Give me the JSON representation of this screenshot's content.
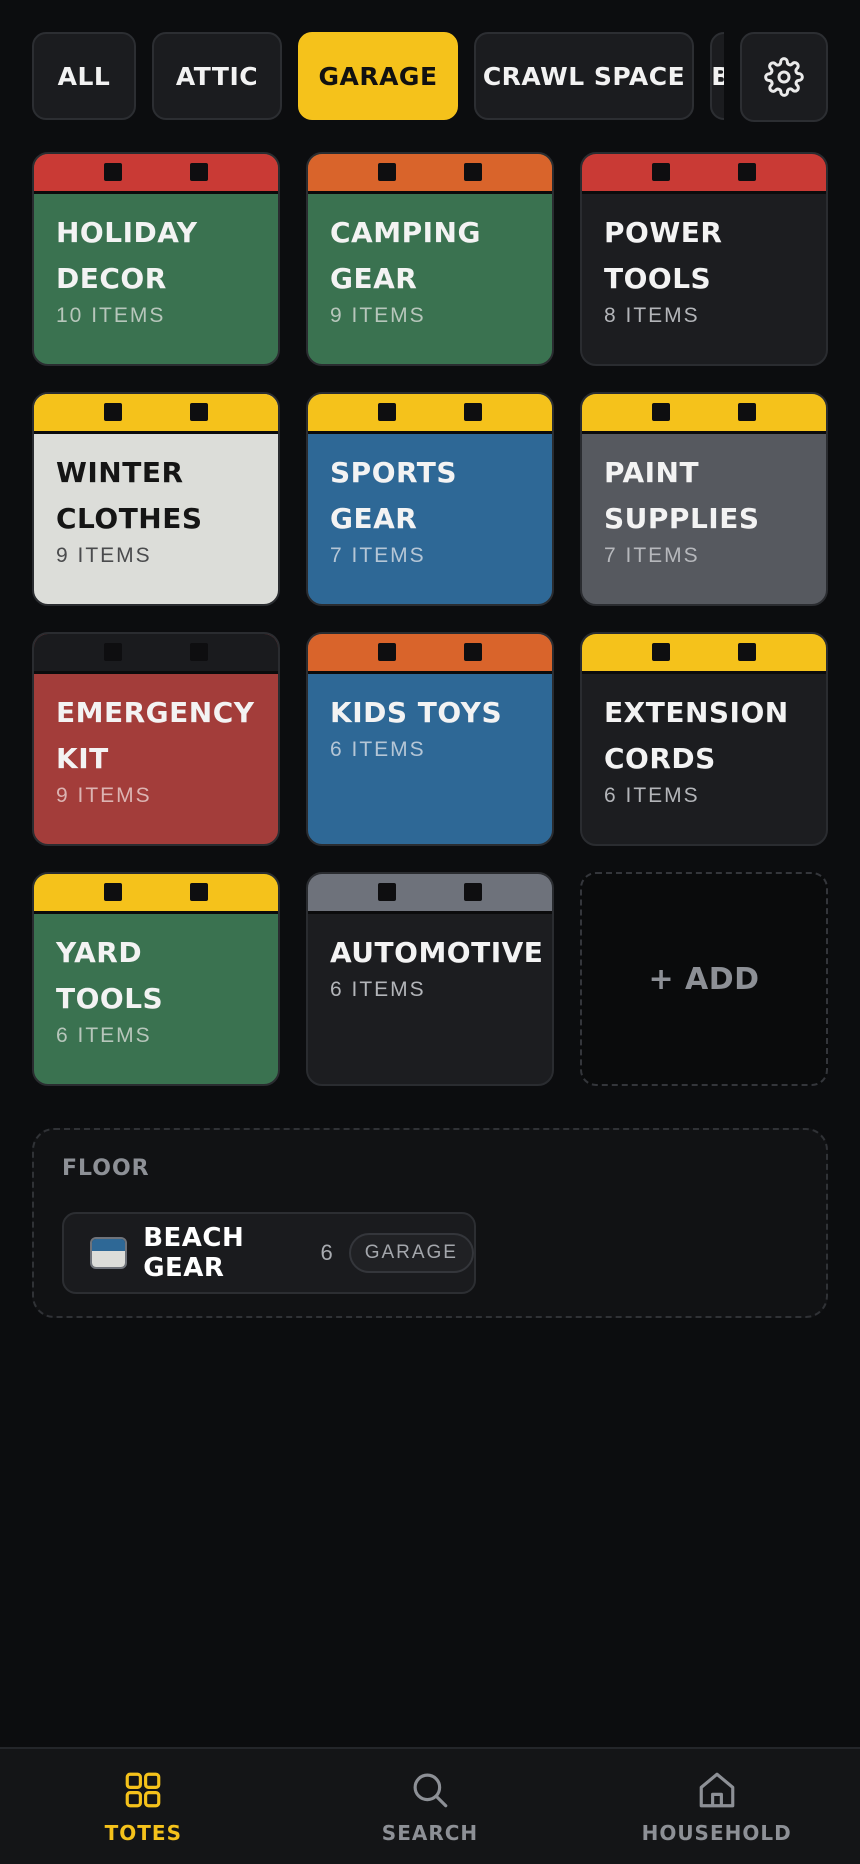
{
  "filters": {
    "chips": [
      "ALL",
      "ATTIC",
      "GARAGE",
      "CRAWL SPACE",
      "BASEMENT"
    ],
    "active": "GARAGE"
  },
  "colors": {
    "accent": "#f5c21b",
    "background": "#0c0d0f"
  },
  "totes": [
    {
      "name": "Holiday Decor",
      "count": "10 ITEMS",
      "lid": "#c93a35",
      "body": "#3a7250",
      "text": "#f3f3f3",
      "countColor": "#b7c6bb"
    },
    {
      "name": "Camping Gear",
      "count": "9 ITEMS",
      "lid": "#d9642b",
      "body": "#3a7250",
      "text": "#f3f3f3",
      "countColor": "#b7c6bb"
    },
    {
      "name": "Power Tools",
      "count": "8 ITEMS",
      "lid": "#c93a35",
      "body": "#1c1d20",
      "text": "#f3f3f3",
      "countColor": "#b3b5b9"
    },
    {
      "name": "Winter Clothes",
      "count": "9 ITEMS",
      "lid": "#f5c21b",
      "body": "#dcddd9",
      "text": "#151515",
      "countColor": "#4a4b4d"
    },
    {
      "name": "Sports Gear",
      "count": "7 ITEMS",
      "lid": "#f5c21b",
      "body": "#2e6896",
      "text": "#f3f3f3",
      "countColor": "#b5c6d6"
    },
    {
      "name": "Paint Supplies",
      "count": "7 ITEMS",
      "lid": "#f5c21b",
      "body": "#56595f",
      "text": "#f3f3f3",
      "countColor": "#b6b8bc"
    },
    {
      "name": "Emergency Kit",
      "count": "9 ITEMS",
      "lid": "#1a1b1e",
      "body": "#a33d3a",
      "text": "#f3f3f3",
      "countColor": "#dcb4b2"
    },
    {
      "name": "Kids Toys",
      "count": "6 ITEMS",
      "lid": "#d9642b",
      "body": "#2e6896",
      "text": "#f3f3f3",
      "countColor": "#b5c6d6"
    },
    {
      "name": "Extension Cords",
      "count": "6 ITEMS",
      "lid": "#f5c21b",
      "body": "#1c1d20",
      "text": "#f3f3f3",
      "countColor": "#b3b5b9"
    },
    {
      "name": "Yard Tools",
      "count": "6 ITEMS",
      "lid": "#f5c21b",
      "body": "#3a7250",
      "text": "#f3f3f3",
      "countColor": "#b7c6bb"
    },
    {
      "name": "Automotive",
      "count": "6 ITEMS",
      "lid": "#6e727b",
      "body": "#1c1d20",
      "text": "#f3f3f3",
      "countColor": "#b3b5b9"
    }
  ],
  "add_tile": {
    "label": "+ ADD"
  },
  "floor": {
    "title": "FLOOR",
    "items": [
      {
        "name": "BEACH GEAR",
        "count": "6",
        "location": "GARAGE"
      }
    ]
  },
  "nav": {
    "items": [
      {
        "label": "TOTES",
        "icon": "grid-icon",
        "active": true
      },
      {
        "label": "SEARCH",
        "icon": "search-icon",
        "active": false
      },
      {
        "label": "HOUSEHOLD",
        "icon": "home-icon",
        "active": false
      }
    ]
  }
}
